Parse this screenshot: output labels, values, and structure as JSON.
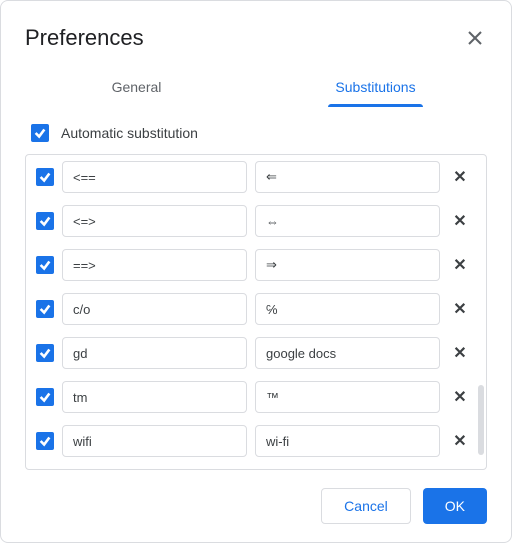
{
  "dialog": {
    "title": "Preferences"
  },
  "tabs": {
    "general": "General",
    "substitutions": "Substitutions"
  },
  "autoSub": {
    "label": "Automatic substitution",
    "checked": true
  },
  "rows": [
    {
      "enabled": true,
      "replace": "<==",
      "with": "⇐"
    },
    {
      "enabled": true,
      "replace": "<=>",
      "with": "⇔"
    },
    {
      "enabled": true,
      "replace": "==>",
      "with": "⇒"
    },
    {
      "enabled": true,
      "replace": "c/o",
      "with": "℅"
    },
    {
      "enabled": true,
      "replace": "gd",
      "with": "google docs"
    },
    {
      "enabled": true,
      "replace": "tm",
      "with": "™"
    },
    {
      "enabled": true,
      "replace": "wifi",
      "with": "wi-fi"
    }
  ],
  "footer": {
    "cancel": "Cancel",
    "ok": "OK"
  }
}
